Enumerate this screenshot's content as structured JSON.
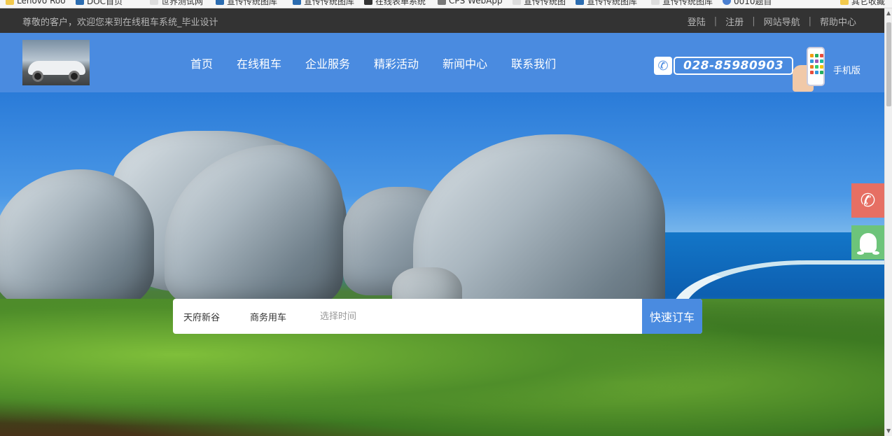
{
  "bookmarks_bar": {
    "items": [
      "Lenovo Roo",
      "DOC首页",
      "世界测试网",
      "宣传传统图库",
      "宣传传统图库",
      "在线表单系统",
      "CPS WebApp",
      "宣传传统图",
      "宣传传统图库",
      "宣传传统图库",
      "0010题目"
    ],
    "folder": "其它收藏"
  },
  "topbar": {
    "welcome": "尊敬的客户，欢迎您来到在线租车系统_毕业设计",
    "links": [
      "登陆",
      "注册",
      "网站导航",
      "帮助中心"
    ],
    "separator": "|"
  },
  "header": {
    "nav": [
      "首页",
      "在线租车",
      "企业服务",
      "精彩活动",
      "新闻中心",
      "联系我们"
    ],
    "phone": "028-85980903",
    "mobile_label": "手机版"
  },
  "search": {
    "location": "天府新谷",
    "car_type": "商务用车",
    "time_placeholder": "选择时间",
    "button": "快速订车"
  },
  "icons": {
    "phone": "phone-icon",
    "qq": "qq-icon",
    "mobile": "mobile-phone-icon"
  },
  "colors": {
    "topbar_bg": "#333333",
    "header_bg": "#4a8be0",
    "button_bg": "#4a8be0",
    "float_phone": "#e66f63",
    "float_qq": "#6dc47a"
  }
}
